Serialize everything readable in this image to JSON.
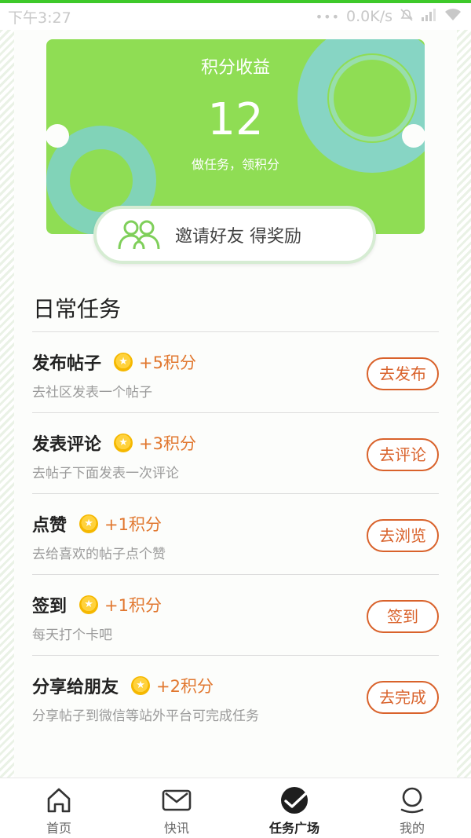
{
  "status_bar": {
    "time": "下午3:27",
    "dots": "•••",
    "speed": "0.0K/s"
  },
  "points_card": {
    "title": "积分收益",
    "value": "12",
    "subtitle": "做任务，领积分"
  },
  "invite": {
    "label": "邀请好友 得奖励"
  },
  "daily_tasks": {
    "title": "日常任务",
    "items": [
      {
        "name": "发布帖子",
        "reward": "+5积分",
        "desc": "去社区发表一个帖子",
        "button": "去发布"
      },
      {
        "name": "发表评论",
        "reward": "+3积分",
        "desc": "去帖子下面发表一次评论",
        "button": "去评论"
      },
      {
        "name": "点赞",
        "reward": "+1积分",
        "desc": "去给喜欢的帖子点个赞",
        "button": "去浏览"
      },
      {
        "name": "签到",
        "reward": "+1积分",
        "desc": "每天打个卡吧",
        "button": "签到"
      },
      {
        "name": "分享给朋友",
        "reward": "+2积分",
        "desc": "分享帖子到微信等站外平台可完成任务",
        "button": "去完成"
      }
    ]
  },
  "tabbar": {
    "items": [
      {
        "label": "首页",
        "icon": "home-icon"
      },
      {
        "label": "快讯",
        "icon": "mail-icon"
      },
      {
        "label": "任务广场",
        "icon": "check-circle-icon",
        "active": true
      },
      {
        "label": "我的",
        "icon": "user-icon"
      }
    ]
  },
  "colors": {
    "card_green": "#8fdd54",
    "accent_orange": "#d9622b",
    "reward_orange": "#e1772f",
    "top_line_green": "#3ec92a"
  }
}
